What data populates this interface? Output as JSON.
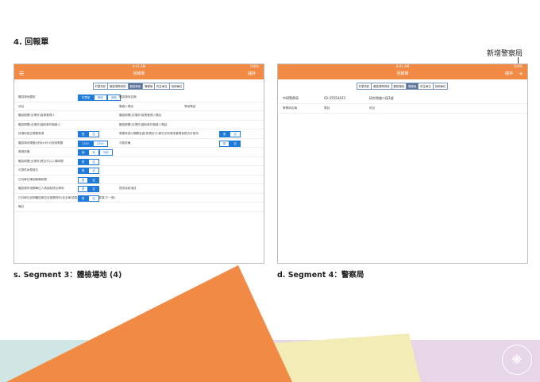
{
  "section_title": "4. 回報單",
  "annotation": "新增警察局",
  "colors": {
    "accent": "#f08a45",
    "tab_active": "#5d7699",
    "toggle_blue": "#1f7ad8",
    "bg_teal": "#cfe6e4",
    "bg_yellow": "#f2edb6",
    "bg_pink": "#e6d6e8"
  },
  "left_screen": {
    "status_time": "9:41 AM",
    "status_battery": "100%",
    "app_title": "回報單",
    "save_label": "儲存",
    "menu_icon": "hamburger-menu-icon",
    "tabs": [
      {
        "label": "村里資訊",
        "active": false
      },
      {
        "label": "體檢場營資訊",
        "active": false
      },
      {
        "label": "體檢場地",
        "active": true
      },
      {
        "label": "警察局",
        "active": false
      },
      {
        "label": "衛生單位",
        "active": false
      },
      {
        "label": "其他單位",
        "active": false
      }
    ],
    "rows": [
      {
        "label": "體檢場地類型",
        "options": [
          "村里室",
          "學校",
          "其他"
        ],
        "selected": 0,
        "extra": "體檢場地名稱"
      },
      {
        "label": "地址",
        "mid": "聯絡人電話",
        "right": "場地電話"
      },
      {
        "label": "體檢期間(全場所)負責管理人",
        "mid": "體檢期間(全場所)負責管理人電話"
      },
      {
        "label": "體檢期間(全場所)臨時事件聯絡人",
        "mid": "體檢期間(全場所)臨時事件聯絡人電話"
      },
      {
        "label": "該場地是否需要電源",
        "options": [
          "是",
          "否"
        ],
        "selected": 0,
        "mid": "需要時須以隔開各處(負責自行)事先告知場地管理者是否可使用",
        "options2": [
          "是",
          "否"
        ],
        "selected2": 0
      },
      {
        "label": "體檢場地電壓(伏特/kW)可使用電壓",
        "options": [
          "110V",
          "220V"
        ],
        "selected": 0,
        "mid": "冷氣設備",
        "options2": [
          "是",
          "否"
        ],
        "selected2": 1
      },
      {
        "label": "電梯設備",
        "options": [
          "無",
          "有",
          "可用"
        ],
        "selected": 0
      },
      {
        "label": "體檢期間(全場所)是否可以入場時間",
        "options": [
          "是",
          "否"
        ],
        "selected": 0
      },
      {
        "label": "可提供休憩座位",
        "options": [
          "是",
          "否"
        ],
        "selected": 0
      },
      {
        "label": "已向單位確認報備時間",
        "options": [
          "是",
          "否"
        ],
        "selected": 1
      },
      {
        "label": "體檢場所相關單位人員協助提出場地",
        "options": [
          "是",
          "否"
        ],
        "selected": 1,
        "mid": "提供協助項目"
      },
      {
        "label": "已向單位說明體檢報告及相關資料(含名單/檢驗/告知/其他/(建議事項)下一期)",
        "options": [
          "是",
          "否"
        ],
        "selected": 0
      },
      {
        "label": "備註"
      }
    ]
  },
  "right_screen": {
    "status_time": "9:41 AM",
    "status_battery": "100%",
    "app_title": "回報單",
    "save_label": "儲存",
    "add_icon": "plus-icon",
    "tabs": [
      {
        "label": "村里資訊",
        "active": false
      },
      {
        "label": "體檢場營資訊",
        "active": false
      },
      {
        "label": "體檢場地",
        "active": false
      },
      {
        "label": "警察局",
        "active": true
      },
      {
        "label": "衛生單位",
        "active": false
      },
      {
        "label": "其他單位",
        "active": false
      }
    ],
    "station_name": "中研警察局",
    "station_phone": "02-25554433",
    "station_address": "研究院路二段1號",
    "header_name": "警察局名稱",
    "header_phone": "電話",
    "header_address": "地址"
  },
  "captions": {
    "left": "s. Segment 3：體檢場地 (4)",
    "right": "d. Segment 4：警察局"
  },
  "logo_icon": "rhombus-emblem-icon"
}
